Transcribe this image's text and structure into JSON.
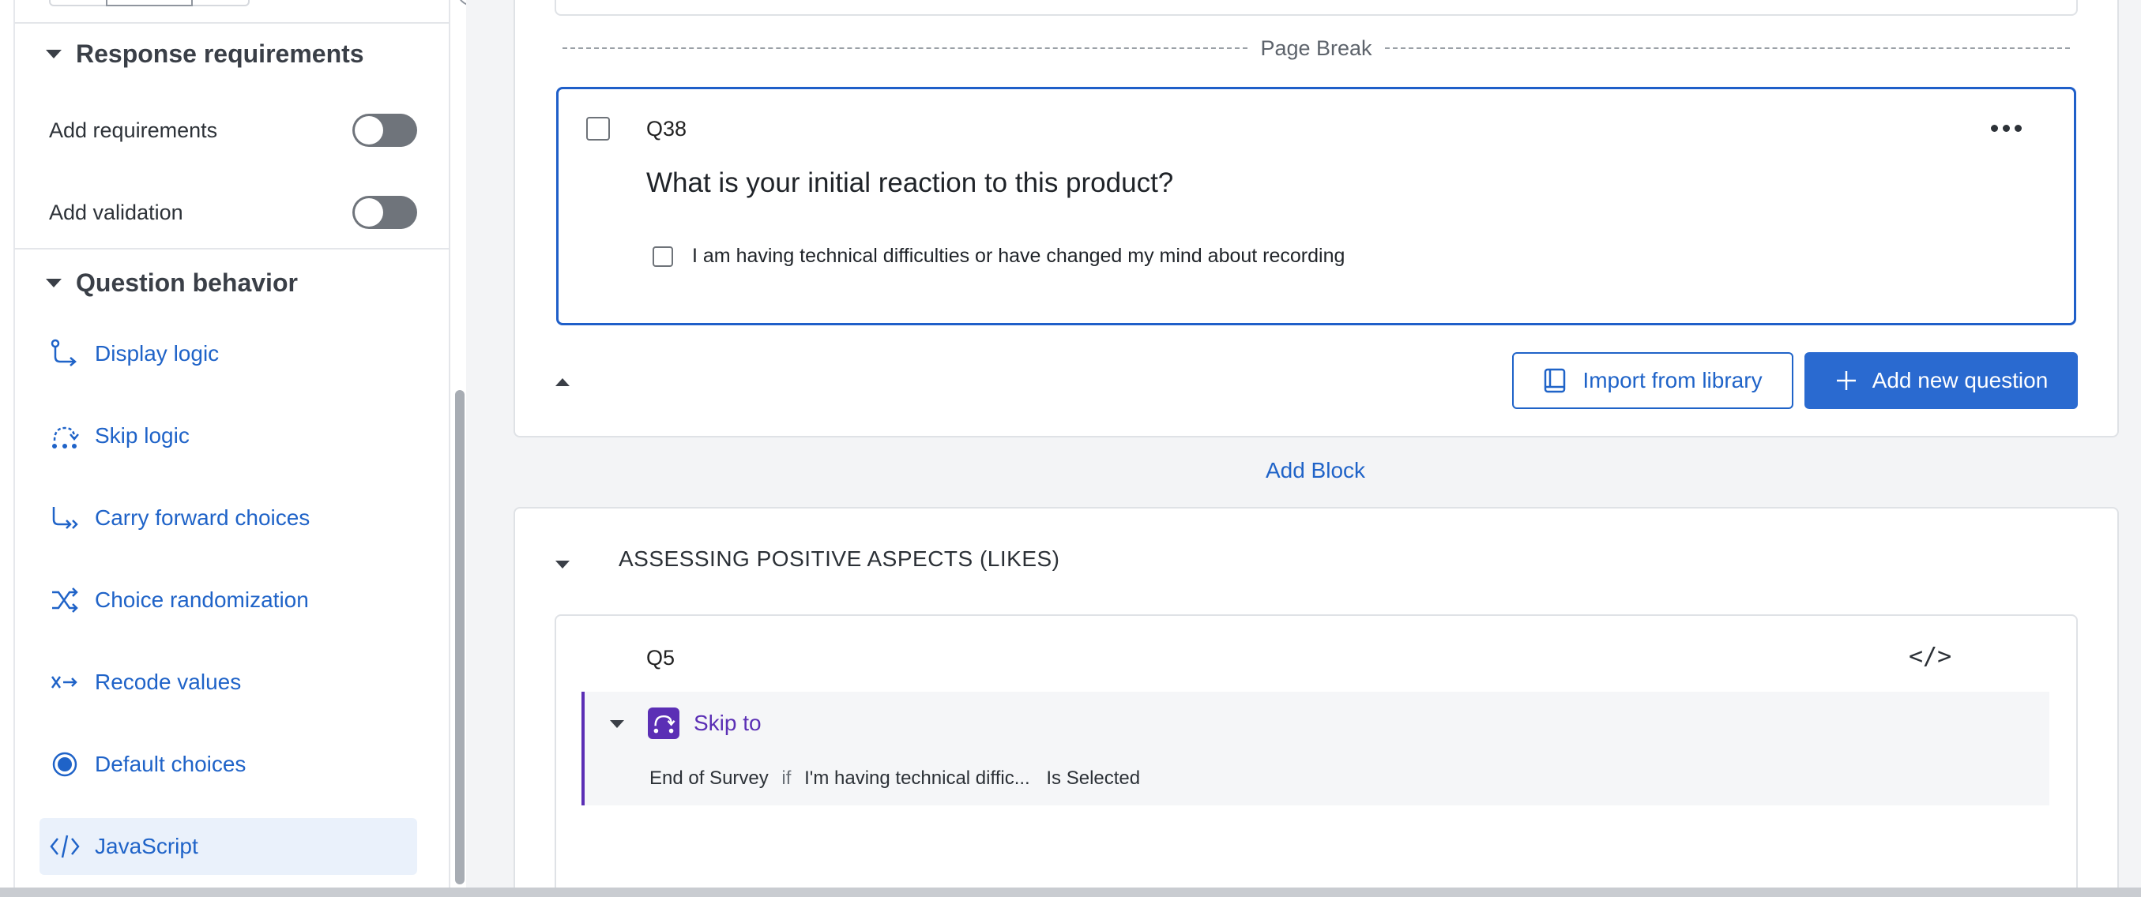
{
  "sidebar": {
    "response_requirements": {
      "heading": "Response requirements",
      "add_requirements_label": "Add requirements",
      "add_validation_label": "Add validation"
    },
    "question_behavior": {
      "heading": "Question behavior",
      "items": [
        {
          "label": "Display logic",
          "icon": "display-logic-icon"
        },
        {
          "label": "Skip logic",
          "icon": "skip-logic-icon"
        },
        {
          "label": "Carry forward choices",
          "icon": "carry-forward-icon"
        },
        {
          "label": "Choice randomization",
          "icon": "shuffle-icon"
        },
        {
          "label": "Recode values",
          "icon": "recode-icon"
        },
        {
          "label": "Default choices",
          "icon": "radio-icon"
        },
        {
          "label": "JavaScript",
          "icon": "code-icon"
        }
      ],
      "active_item": "JavaScript"
    }
  },
  "main": {
    "page_break_label": "Page Break",
    "q38": {
      "id": "Q38",
      "text": "What is your initial reaction to this product?",
      "choice": "I am having technical difficulties or have changed my mind about recording"
    },
    "import_button_label": "Import from library",
    "add_question_button_label": "Add new question",
    "add_block_label": "Add Block",
    "block_title": "ASSESSING POSITIVE ASPECTS (LIKES)",
    "q5": {
      "id": "Q5",
      "code_icon_text": "</>",
      "skip": {
        "label": "Skip to",
        "destination": "End of Survey",
        "connector": "if",
        "choice": "I'm having technical diffic...",
        "condition": "Is Selected"
      }
    }
  },
  "colors": {
    "accent_blue": "#1f63c8",
    "selected_border": "#1f5fc9",
    "skip_purple": "#5b2fb5",
    "toggle_off": "#6f747b"
  }
}
